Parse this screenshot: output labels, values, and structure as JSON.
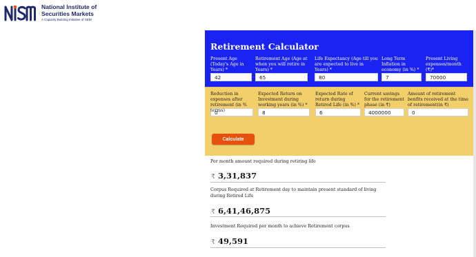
{
  "brand": {
    "logo_text": "NISM",
    "name_line1": "National Institute of",
    "name_line2": "Securities Markets",
    "tagline": "A Capacity Building Initiative of SEBI",
    "color": "#1f2a6b"
  },
  "calculator": {
    "title": "Retirement Calculator",
    "colors": {
      "blue": "#1b23f0",
      "yellow": "#f3cf6b",
      "button": "#e8500e"
    },
    "fields_row1": [
      {
        "label": "Present Age (Today's Age in Years) *",
        "value": "42"
      },
      {
        "label": "Retirement Age (Age at when you will retire in Years) *",
        "value": "65"
      },
      {
        "label": "Life Expectancy (Age till you are expected to live in Years) *",
        "value": "80"
      },
      {
        "label": "Long Term Inflation in economy (in %) *",
        "value": "7"
      },
      {
        "label": "Present Living expenses/month (₹)*",
        "value": "70000"
      }
    ],
    "fields_row2": [
      {
        "label": "Reduction in expenses after retirement (in % terms)",
        "value": "0"
      },
      {
        "label": "Expected Return on Investment during working years (in %) *",
        "value": "8"
      },
      {
        "label": "Expected Rate of return during Retired Life (in %) *",
        "value": "6"
      },
      {
        "label": "Current savings for the retirement phase (in ₹)",
        "value": "4000000"
      },
      {
        "label": "Amount of retirement benfits received at the time of retirement(in ₹)",
        "value": "0"
      }
    ],
    "calculate_label": "Calculate",
    "currency_symbol": "₹",
    "results": [
      {
        "label": "Per month amount required during retiring life",
        "value": "3,31,837"
      },
      {
        "label": "Corpus Required at Retirement day to maintain present standard of living during Retired Life",
        "value": "6,41,46,875"
      },
      {
        "label": "Investment Required per month to achieve Retirement corpus",
        "value": "49,591"
      }
    ]
  }
}
